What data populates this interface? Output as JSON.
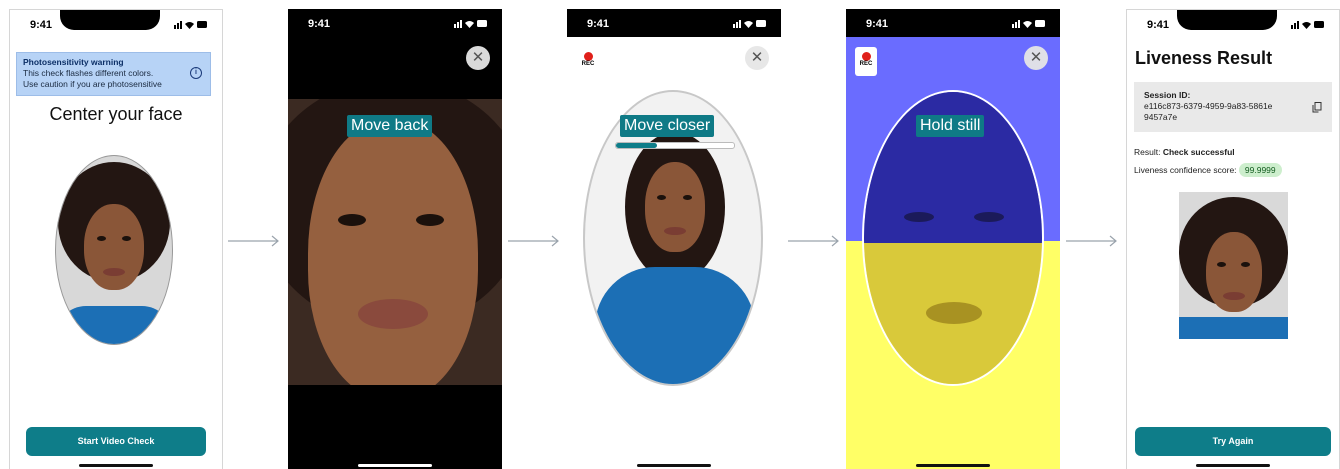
{
  "status": {
    "time": "9:41"
  },
  "screen1": {
    "warning_title": "Photosensitivity warning",
    "warning_line1": "This check flashes different colors.",
    "warning_line2": "Use caution if you are photosensitive",
    "heading": "Center your face",
    "button": "Start Video Check"
  },
  "screen2": {
    "hint": "Move back",
    "close": "✕"
  },
  "screen3": {
    "rec": "REC",
    "hint": "Move closer",
    "close": "✕",
    "progress": 0.35
  },
  "screen4": {
    "rec": "REC",
    "hint": "Hold still",
    "close": "✕"
  },
  "screen5": {
    "title": "Liveness Result",
    "session_label": "Session ID:",
    "session_line1": "e116c873-6379-4959-9a83-5861e",
    "session_line2": "9457a7e",
    "result_label": "Result: ",
    "result_value": "Check successful",
    "score_label": "Liveness confidence score: ",
    "score_value": "99.9999",
    "button": "Try Again"
  },
  "colors": {
    "accent": "#0e7d89",
    "blue_flash": "#6a6cff",
    "yellow_flash": "#ffff66",
    "warning_bg": "#b7d3f6",
    "score_badge": "#cdeecd"
  }
}
